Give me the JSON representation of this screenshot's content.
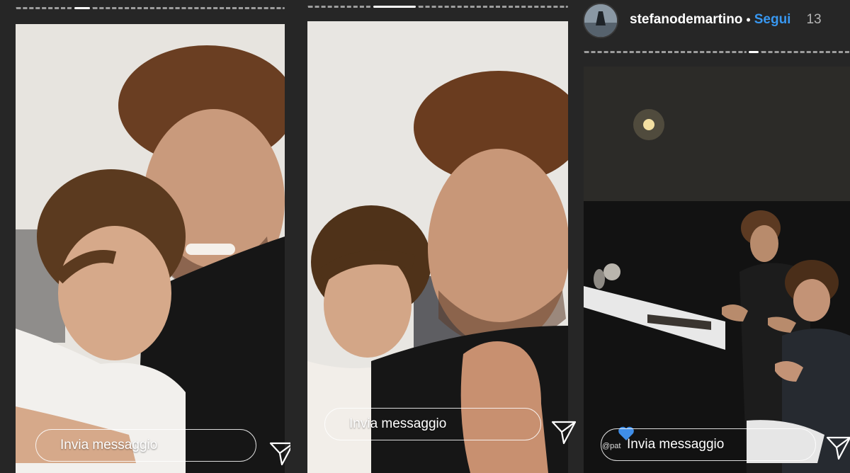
{
  "stories": [
    {
      "id": "story-1",
      "message_placeholder": "Invia messaggio"
    },
    {
      "id": "story-2",
      "message_placeholder": "Invia messaggio"
    },
    {
      "id": "story-3",
      "message_placeholder": "Invia messaggio",
      "mention_text": "@pat"
    }
  ],
  "header": {
    "username": "stefanodemartino",
    "separator": "•",
    "follow_label": "Segui",
    "timestamp": "13"
  },
  "icons": {
    "send": "paper-plane-icon",
    "heart": "heart-icon",
    "avatar": "profile-avatar"
  },
  "colors": {
    "background": "#262626",
    "follow_blue": "#3897f0",
    "heart_blue": "#3f8ee8"
  }
}
